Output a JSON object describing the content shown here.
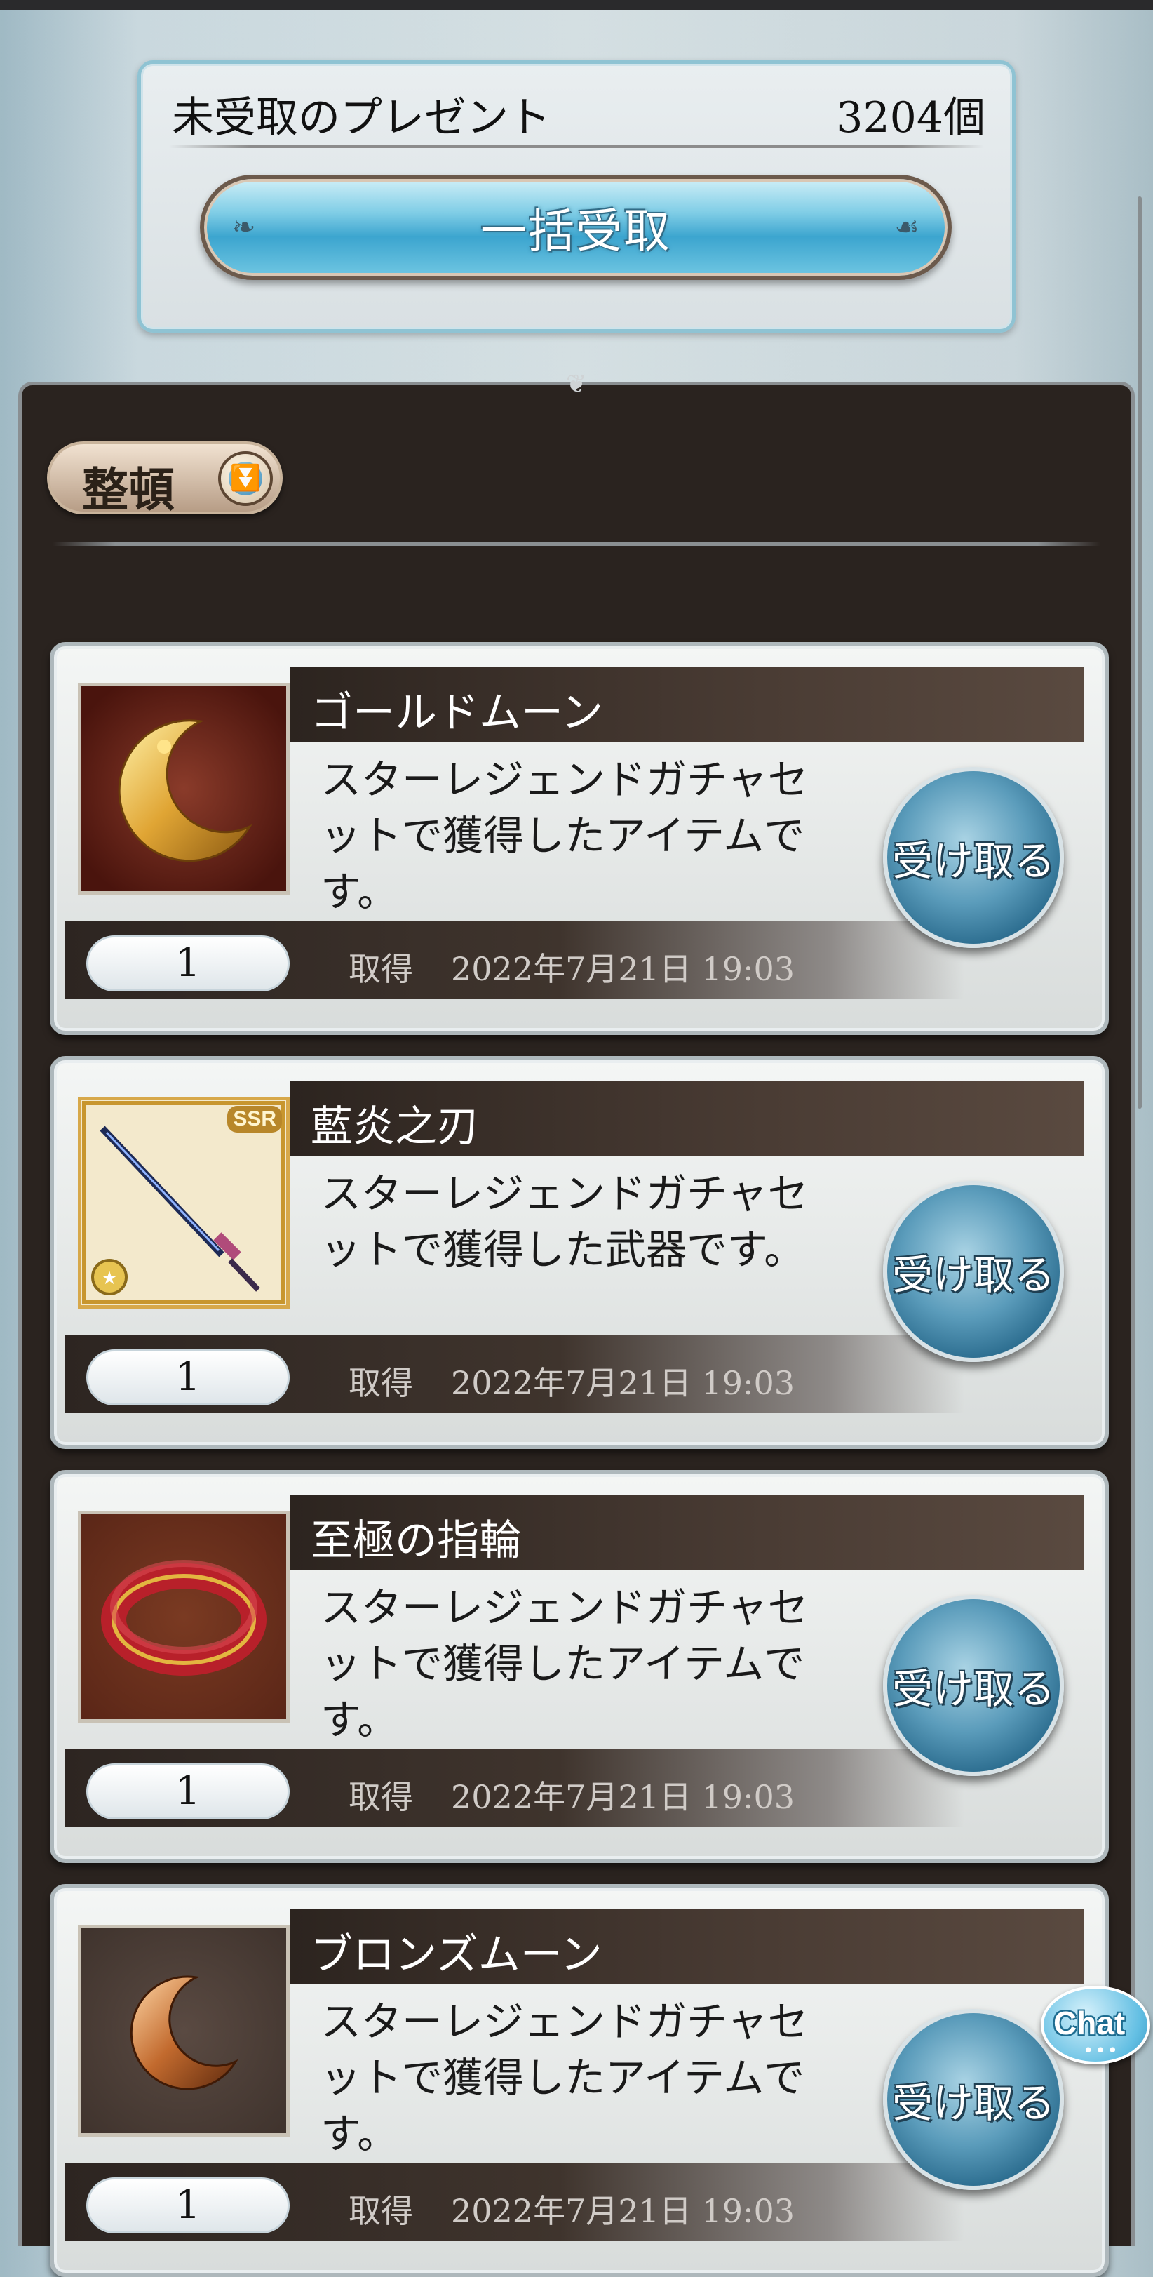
{
  "header": {
    "title": "未受取のプレゼント",
    "count": "3204個",
    "receive_all_label": "一括受取"
  },
  "list": {
    "sort_label": "整頓"
  },
  "receive_button_label": "受け取る",
  "acquired_label": "取得",
  "items": [
    {
      "name": "ゴールドムーン",
      "description": "スターレジェンドガチャセ\nットで獲得したアイテムで\nす。",
      "quantity": "1",
      "date": "2022年7月21日 19:03",
      "icon": "gold-moon-icon"
    },
    {
      "name": "藍炎之刃",
      "description": "スターレジェンドガチャセ\nットで獲得した武器です。",
      "quantity": "1",
      "date": "2022年7月21日 19:03",
      "icon": "sword-icon",
      "rarity": "SSR"
    },
    {
      "name": "至極の指輪",
      "description": "スターレジェンドガチャセ\nットで獲得したアイテムで\nす。",
      "quantity": "1",
      "date": "2022年7月21日 19:03",
      "icon": "ring-icon"
    },
    {
      "name": "ブロンズムーン",
      "description": "スターレジェンドガチャセ\nットで獲得したアイテムで\nす。",
      "quantity": "1",
      "date": "2022年7月21日 19:03",
      "icon": "bronze-moon-icon"
    }
  ],
  "chat": {
    "label": "Chat",
    "dots": "•••"
  }
}
